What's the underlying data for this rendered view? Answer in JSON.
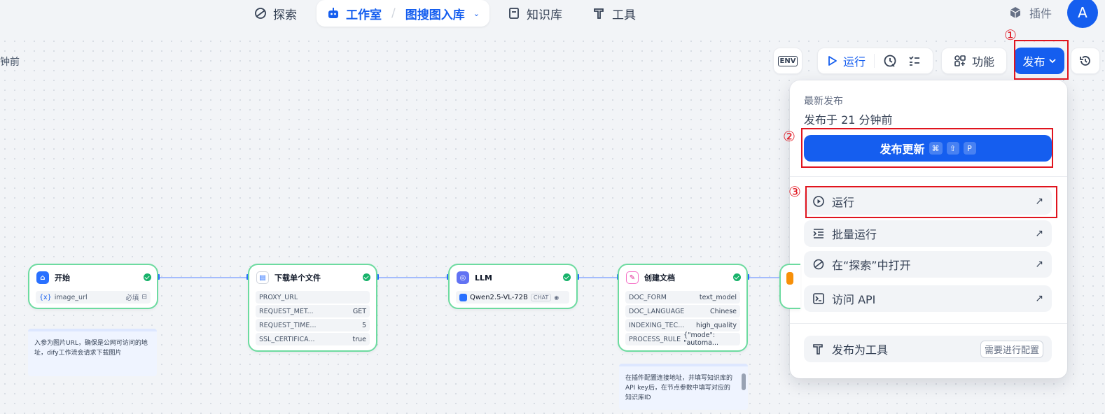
{
  "nav": {
    "explore": "探索",
    "studio": "工作室",
    "app_name": "图搜图入库",
    "knowledge": "知识库",
    "tools": "工具",
    "plugins": "插件",
    "avatar_letter": "A"
  },
  "canvas": {
    "time_label": "钟前"
  },
  "toolbar": {
    "env": "ENV",
    "run": "运行",
    "features": "功能",
    "publish": "发布"
  },
  "annotations": {
    "n1": "①",
    "n2": "②",
    "n3": "③"
  },
  "publish_menu": {
    "latest_label": "最新发布",
    "published_time": "发布于 21 分钟前",
    "update_button": "发布更新",
    "shortcut": [
      "⌘",
      "⇧",
      "P"
    ],
    "items": [
      {
        "label": "运行",
        "icon": "play-circle-icon"
      },
      {
        "label": "批量运行",
        "icon": "batch-list-icon"
      },
      {
        "label": "在“探索”中打开",
        "icon": "explore-icon"
      },
      {
        "label": "访问 API",
        "icon": "terminal-icon"
      }
    ],
    "tool_item": {
      "label": "发布为工具",
      "badge": "需要进行配置"
    },
    "external_arrow": "↗"
  },
  "nodes": {
    "start": {
      "title": "开始",
      "var_prefix": "{x}",
      "var": "image_url",
      "required": "必填"
    },
    "download": {
      "title": "下载单个文件",
      "rows": [
        {
          "k": "PROXY_URL",
          "v": ""
        },
        {
          "k": "REQUEST_MET...",
          "v": "GET"
        },
        {
          "k": "REQUEST_TIME...",
          "v": "5"
        },
        {
          "k": "SSL_CERTIFICA...",
          "v": "true"
        }
      ]
    },
    "llm": {
      "title": "LLM",
      "model": "Qwen2.5-VL-72B",
      "mode": "CHAT"
    },
    "doc": {
      "title": "创建文档",
      "rows": [
        {
          "k": "DOC_FORM",
          "v": "text_model"
        },
        {
          "k": "DOC_LANGUAGE",
          "v": "Chinese"
        },
        {
          "k": "INDEXING_TEC...",
          "v": "high_quality"
        },
        {
          "k": "PROCESS_RULE",
          "v": "{\"mode\": \"automa..."
        }
      ]
    }
  },
  "notes": {
    "start_note": "入参为图片URL，确保是公网可访问的地址，dify工作流会请求下载图片",
    "doc_note": "在插件配置连接地址，并填写知识库的API key后，在节点参数中填写对应的知识库ID"
  },
  "colors": {
    "accent": "#155eef",
    "success": "#17b26a",
    "annotation_red": "#e0141e"
  }
}
